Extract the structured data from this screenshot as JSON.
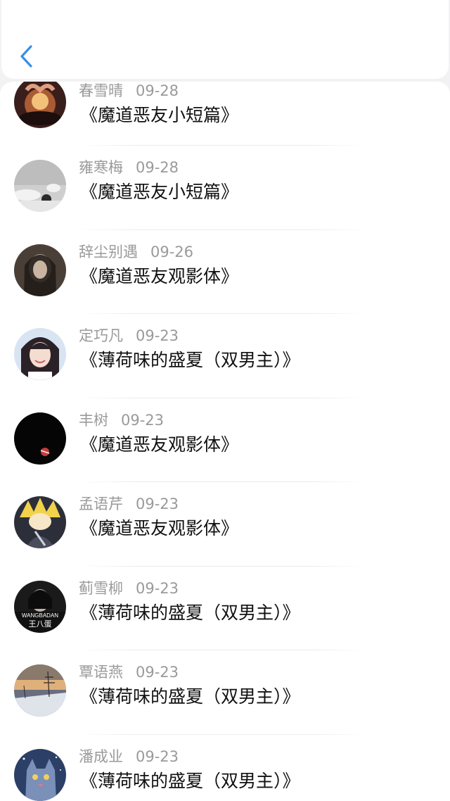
{
  "nav": {
    "back_icon": "chevron-left-icon",
    "accent": "#3a8ee6"
  },
  "items": [
    {
      "user": "春雪晴",
      "date": "09-28",
      "title": "《魔道恶友小短篇》",
      "avatar": "avatar-hands-heart"
    },
    {
      "user": "雍寒梅",
      "date": "09-28",
      "title": "《魔道恶友小短篇》",
      "avatar": "avatar-gray-sky"
    },
    {
      "user": "辞尘别遇",
      "date": "09-26",
      "title": "《魔道恶友观影体》",
      "avatar": "avatar-dark-girl"
    },
    {
      "user": "定巧凡",
      "date": "09-23",
      "title": "《薄荷味的盛夏（双男主）》",
      "avatar": "avatar-smiling-girl"
    },
    {
      "user": "丰树",
      "date": "09-23",
      "title": "《魔道恶友观影体》",
      "avatar": "avatar-black-red"
    },
    {
      "user": "孟语芹",
      "date": "09-23",
      "title": "《魔道恶友观影体》",
      "avatar": "avatar-anime-yellow"
    },
    {
      "user": "蓟雪柳",
      "date": "09-23",
      "title": "《薄荷味的盛夏（双男主）》",
      "avatar": "avatar-wangbadan",
      "avatar_text_top": "WANGBADAN",
      "avatar_text_bottom": "王八蛋"
    },
    {
      "user": "覃语燕",
      "date": "09-23",
      "title": "《薄荷味的盛夏（双男主）》",
      "avatar": "avatar-winter-sunset"
    },
    {
      "user": "潘成业",
      "date": "09-23",
      "title": "《薄荷味的盛夏（双男主）》",
      "avatar": "avatar-blue-cat"
    }
  ]
}
